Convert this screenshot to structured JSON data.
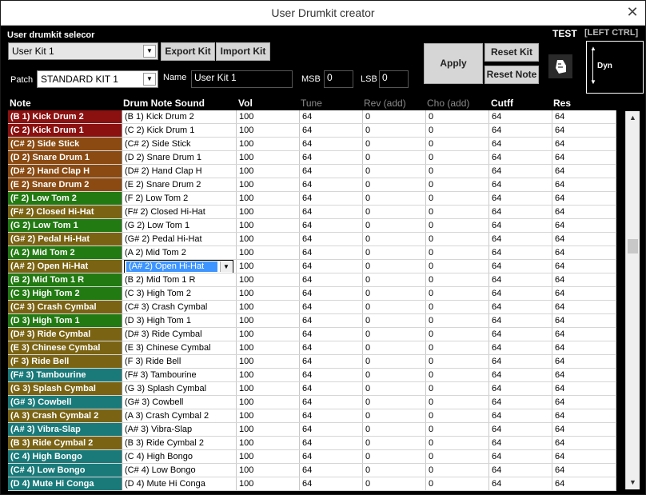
{
  "window": {
    "title": "User Drumkit creator"
  },
  "top": {
    "selector_label": "User drumkit selecor",
    "selector_value": "User Kit 1",
    "export_label": "Export Kit",
    "import_label": "Import Kit",
    "patch_label": "Patch",
    "patch_value": "STANDARD KIT 1",
    "name_label": "Name",
    "name_value": "User Kit 1",
    "msb_label": "MSB",
    "msb_value": "0",
    "lsb_label": "LSB",
    "lsb_value": "0",
    "apply_label": "Apply",
    "reset_kit_label": "Reset Kit",
    "reset_note_label": "Reset Note",
    "test_label": "TEST",
    "ctrl_label": "[LEFT CTRL]",
    "dyn_label": "Dyn"
  },
  "columns": [
    "Note",
    "Drum Note Sound",
    "Vol",
    "Tune",
    "Rev (add)",
    "Cho (add)",
    "Cutff",
    "Res"
  ],
  "rows": [
    {
      "note": "(B 1) Kick Drum 2",
      "sound": "(B 1) Kick Drum 2",
      "color": "#8b1010"
    },
    {
      "note": "(C 2) Kick Drum 1",
      "sound": "(C 2) Kick Drum 1",
      "color": "#8b1010"
    },
    {
      "note": "(C# 2) Side Stick",
      "sound": "(C# 2) Side Stick",
      "color": "#8a4a12"
    },
    {
      "note": "(D 2) Snare Drum 1",
      "sound": "(D 2) Snare Drum 1",
      "color": "#8a4a12"
    },
    {
      "note": "(D# 2) Hand Clap H",
      "sound": "(D# 2) Hand Clap H",
      "color": "#8a4a12"
    },
    {
      "note": "(E 2) Snare Drum 2",
      "sound": "(E 2) Snare Drum 2",
      "color": "#8a4a12"
    },
    {
      "note": "(F 2) Low Tom 2",
      "sound": "(F 2) Low Tom 2",
      "color": "#227a12"
    },
    {
      "note": "(F# 2) Closed Hi-Hat",
      "sound": "(F# 2) Closed Hi-Hat",
      "color": "#7a6414"
    },
    {
      "note": "(G 2) Low Tom 1",
      "sound": "(G 2) Low Tom 1",
      "color": "#227a12"
    },
    {
      "note": "(G# 2) Pedal Hi-Hat",
      "sound": "(G# 2) Pedal Hi-Hat",
      "color": "#7a6414"
    },
    {
      "note": "(A 2) Mid Tom 2",
      "sound": "(A 2) Mid Tom 2",
      "color": "#227a12"
    },
    {
      "note": "(A# 2) Open Hi-Hat",
      "sound": "(A# 2) Open Hi-Hat",
      "color": "#7a6414"
    },
    {
      "note": "(B 2) Mid Tom 1 R",
      "sound": "(B 2) Mid Tom 1 R",
      "color": "#227a12"
    },
    {
      "note": "(C 3) High Tom 2",
      "sound": "(C 3) High Tom 2",
      "color": "#227a12"
    },
    {
      "note": "(C# 3) Crash Cymbal",
      "sound": "(C# 3) Crash Cymbal",
      "color": "#7a6414"
    },
    {
      "note": "(D 3) High Tom 1",
      "sound": "(D 3) High Tom 1",
      "color": "#227a12"
    },
    {
      "note": "(D# 3) Ride Cymbal",
      "sound": "(D# 3) Ride Cymbal",
      "color": "#7a6414"
    },
    {
      "note": "(E 3) Chinese Cymbal",
      "sound": "(E 3) Chinese Cymbal",
      "color": "#7a6414"
    },
    {
      "note": "(F 3) Ride Bell",
      "sound": "(F 3) Ride Bell",
      "color": "#7a6414"
    },
    {
      "note": "(F# 3) Tambourine",
      "sound": "(F# 3) Tambourine",
      "color": "#1a7a7a"
    },
    {
      "note": "(G 3) Splash Cymbal",
      "sound": "(G 3) Splash Cymbal",
      "color": "#7a6414"
    },
    {
      "note": "(G# 3) Cowbell",
      "sound": "(G# 3) Cowbell",
      "color": "#1a7a7a"
    },
    {
      "note": "(A 3) Crash Cymbal 2",
      "sound": "(A 3) Crash Cymbal 2",
      "color": "#7a6414"
    },
    {
      "note": "(A# 3) Vibra-Slap",
      "sound": "(A# 3) Vibra-Slap",
      "color": "#1a7a7a"
    },
    {
      "note": "(B 3) Ride Cymbal 2",
      "sound": "(B 3) Ride Cymbal 2",
      "color": "#7a6414"
    },
    {
      "note": "(C 4) High Bongo",
      "sound": "(C 4) High Bongo",
      "color": "#1a7a7a"
    },
    {
      "note": "(C# 4) Low Bongo",
      "sound": "(C# 4) Low Bongo",
      "color": "#1a7a7a"
    },
    {
      "note": "(D 4) Mute Hi Conga",
      "sound": "(D 4) Mute Hi Conga",
      "color": "#1a7a7a"
    }
  ],
  "defaults": {
    "vol": "100",
    "tune": "64",
    "rev": "0",
    "cho": "0",
    "cutoff": "64",
    "res": "64"
  },
  "selected_row": 11
}
